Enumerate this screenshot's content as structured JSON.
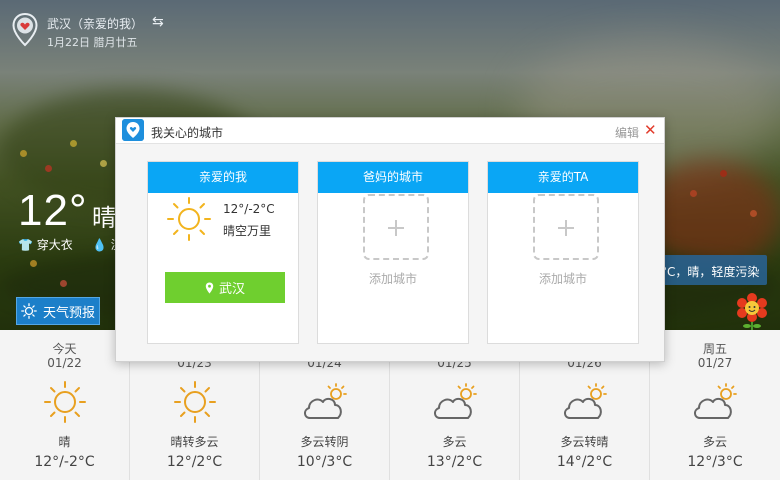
{
  "header": {
    "city": "武汉（亲爱的我）",
    "date": "1月22日 腊月廿五"
  },
  "current": {
    "temp": "12°",
    "condition": "晴",
    "clothing": "穿大衣",
    "humidity_label": "湿",
    "air_quality": "°C，晴，轻度污染",
    "forecast_button": "天气预报"
  },
  "forecast": [
    {
      "name": "今天",
      "date": "01/22",
      "icon": "sun-icon",
      "desc": "晴",
      "temp": "12°/-2°C"
    },
    {
      "name": "",
      "date": "01/23",
      "icon": "sun-icon",
      "desc": "晴转多云",
      "temp": "12°/2°C"
    },
    {
      "name": "",
      "date": "01/24",
      "icon": "cloud-sun-icon",
      "desc": "多云转阴",
      "temp": "10°/3°C"
    },
    {
      "name": "",
      "date": "01/25",
      "icon": "cloud-sun-icon",
      "desc": "多云",
      "temp": "13°/2°C"
    },
    {
      "name": "",
      "date": "01/26",
      "icon": "cloud-sun-icon",
      "desc": "多云转晴",
      "temp": "14°/2°C"
    },
    {
      "name": "周五",
      "date": "01/27",
      "icon": "cloud-sun-icon",
      "desc": "多云",
      "temp": "12°/3°C"
    }
  ],
  "modal": {
    "title": "我关心的城市",
    "edit": "编辑",
    "close": "✕",
    "cards": [
      {
        "title": "亲爱的我",
        "temp": "12°/-2°C",
        "desc": "晴空万里",
        "city": "武汉"
      },
      {
        "title": "爸妈的城市",
        "add_label": "添加城市"
      },
      {
        "title": "亲爱的TA",
        "add_label": "添加城市"
      }
    ]
  },
  "colors": {
    "accent_blue": "#0aa6f5",
    "city_green": "#6fcf2f",
    "sun_orange": "#e8a020",
    "close_red": "#e23c2c"
  }
}
